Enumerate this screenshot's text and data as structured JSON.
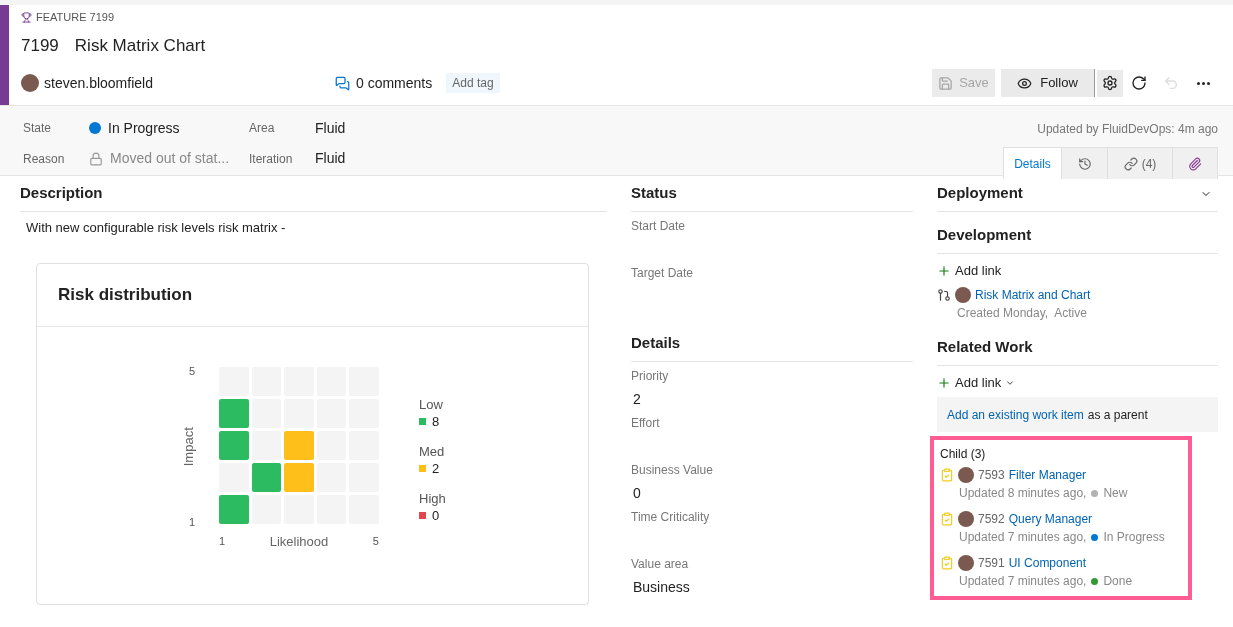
{
  "header": {
    "type_label": "FEATURE 7199",
    "id": "7199",
    "title": "Risk Matrix Chart",
    "assignee": "steven.bloomfield",
    "comments": "0 comments",
    "add_tag": "Add tag"
  },
  "toolbar": {
    "save": {
      "label": "Save",
      "disabled": true
    },
    "follow": {
      "label": "Follow"
    },
    "icons": [
      {
        "kind": "settings",
        "disabled": false
      },
      {
        "kind": "refresh",
        "disabled": false
      },
      {
        "kind": "undo",
        "disabled": true
      },
      {
        "kind": "more",
        "disabled": false
      }
    ]
  },
  "fields": [
    {
      "label": "State",
      "value": "In Progress",
      "kind": "state",
      "color": "#0078d4"
    },
    {
      "label": "Area",
      "value": "Fluid",
      "kind": "text"
    },
    {
      "label": "Reason",
      "value": "Moved out of stat...",
      "kind": "locked"
    },
    {
      "label": "Iteration",
      "value": "Fluid",
      "kind": "text"
    }
  ],
  "updated": "Updated by FluidDevOps: 4m ago",
  "tabs": [
    {
      "kind": "details",
      "label": "Details",
      "selected": true
    },
    {
      "kind": "history",
      "selected": false
    },
    {
      "kind": "links",
      "label": "(4)",
      "selected": false
    },
    {
      "kind": "attachments",
      "selected": false
    }
  ],
  "description": {
    "heading": "Description",
    "text": "With new configurable risk levels risk matrix -"
  },
  "risk_card": {
    "title": "Risk distribution",
    "y_max": "5",
    "y_min": "1",
    "y_label": "Impact",
    "x_min": "1",
    "x_max": "5",
    "x_label": "Likelihood",
    "rows": [
      {
        "cells": [
          {
            "kind": "none"
          },
          {
            "kind": "none"
          },
          {
            "kind": "none"
          },
          {
            "kind": "none"
          },
          {
            "kind": "none"
          }
        ]
      },
      {
        "cells": [
          {
            "kind": "low"
          },
          {
            "kind": "none"
          },
          {
            "kind": "none"
          },
          {
            "kind": "none"
          },
          {
            "kind": "none"
          }
        ]
      },
      {
        "cells": [
          {
            "kind": "low"
          },
          {
            "kind": "none"
          },
          {
            "kind": "med"
          },
          {
            "kind": "none"
          },
          {
            "kind": "none"
          }
        ]
      },
      {
        "cells": [
          {
            "kind": "none"
          },
          {
            "kind": "low"
          },
          {
            "kind": "med"
          },
          {
            "kind": "none"
          },
          {
            "kind": "none"
          }
        ]
      },
      {
        "cells": [
          {
            "kind": "low"
          },
          {
            "kind": "none"
          },
          {
            "kind": "none"
          },
          {
            "kind": "none"
          },
          {
            "kind": "none"
          }
        ]
      }
    ],
    "legend": [
      {
        "kind": "low",
        "label": "Low",
        "count": "8",
        "color": "#2dbb61"
      },
      {
        "kind": "med",
        "label": "Med",
        "count": "2",
        "color": "#ffbf1a"
      },
      {
        "kind": "high",
        "label": "High",
        "count": "0",
        "color": "#e1474b"
      }
    ]
  },
  "status": {
    "heading": "Status",
    "fields": [
      {
        "label": "Start Date"
      },
      {
        "label": "Target Date"
      }
    ]
  },
  "details": {
    "heading": "Details",
    "fields": [
      {
        "label": "Priority",
        "value": "2"
      },
      {
        "label": "Effort"
      },
      {
        "label": "Business Value",
        "value": "0"
      },
      {
        "label": "Time Criticality"
      },
      {
        "label": "Value area",
        "value": "Business"
      }
    ]
  },
  "deployment": {
    "heading": "Deployment",
    "expanded": false
  },
  "development": {
    "heading": "Development",
    "add_link": "Add link",
    "links": [
      {
        "title": "Risk Matrix and Chart",
        "meta": "Created Monday,  Active"
      }
    ]
  },
  "related_work": {
    "heading": "Related Work",
    "add_link": "Add link",
    "hint_link": "Add an existing work item",
    "hint_rest": "as a parent",
    "child_group": {
      "label": "Child (3)",
      "highlighted": true,
      "items": [
        {
          "id": "7593",
          "title": "Filter Manager",
          "updated": "Updated 8 minutes ago,",
          "state": "New",
          "color": "#b2b2b2"
        },
        {
          "id": "7592",
          "title": "Query Manager",
          "updated": "Updated 7 minutes ago,",
          "state": "In Progress",
          "color": "#0078d4"
        },
        {
          "id": "7591",
          "title": "UI Component",
          "updated": "Updated 7 minutes ago,",
          "state": "Done",
          "color": "#339933"
        }
      ]
    }
  }
}
